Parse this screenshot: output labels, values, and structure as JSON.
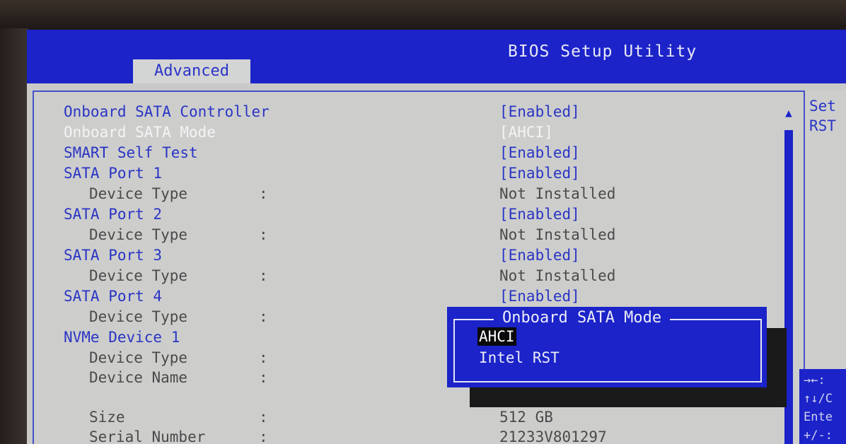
{
  "header": {
    "title": "BIOS Setup Utility",
    "active_tab": "Advanced"
  },
  "settings": [
    {
      "label": "Onboard SATA Controller",
      "value": "[Enabled]",
      "type": "option"
    },
    {
      "label": "Onboard SATA Mode",
      "value": "[AHCI]",
      "type": "option",
      "highlighted": true
    },
    {
      "label": "SMART Self Test",
      "value": "[Enabled]",
      "type": "option"
    },
    {
      "label": "SATA Port 1",
      "value": "[Enabled]",
      "type": "option"
    },
    {
      "label": "Device Type",
      "colon": ":",
      "value": "Not Installed",
      "type": "info"
    },
    {
      "label": "SATA Port 2",
      "value": "[Enabled]",
      "type": "option"
    },
    {
      "label": "Device Type",
      "colon": ":",
      "value": "Not Installed",
      "type": "info"
    },
    {
      "label": "SATA Port 3",
      "value": "[Enabled]",
      "type": "option"
    },
    {
      "label": "Device Type",
      "colon": ":",
      "value": "Not Installed",
      "type": "info"
    },
    {
      "label": "SATA Port 4",
      "value": "[Enabled]",
      "type": "option"
    },
    {
      "label": "Device Type",
      "colon": ":",
      "value": "",
      "type": "info"
    },
    {
      "label": "NVMe Device 1",
      "value": "",
      "type": "option"
    },
    {
      "label": "Device Type",
      "colon": ":",
      "value": "",
      "type": "info"
    },
    {
      "label": "Device Name",
      "colon": ":",
      "value": "",
      "type": "info"
    },
    {
      "label": "Size",
      "colon": ":",
      "value": "512 GB",
      "type": "info"
    },
    {
      "label": "Serial Number",
      "colon": ":",
      "value": "21233V801297",
      "type": "info"
    }
  ],
  "help_panel": {
    "lines": [
      "Set",
      "RST"
    ]
  },
  "key_hints": [
    "→←:",
    "↑↓/C",
    "Ente",
    "+/-:"
  ],
  "popup": {
    "title": "Onboard SATA Mode",
    "options": [
      {
        "label": "AHCI",
        "selected": true
      },
      {
        "label": "Intel RST",
        "selected": false
      }
    ]
  },
  "scrollbar": {
    "up_arrow": "▲"
  },
  "colors": {
    "bios_blue": "#1b23c9",
    "background": "#cdcecc",
    "label_blue": "#2a34c4"
  }
}
